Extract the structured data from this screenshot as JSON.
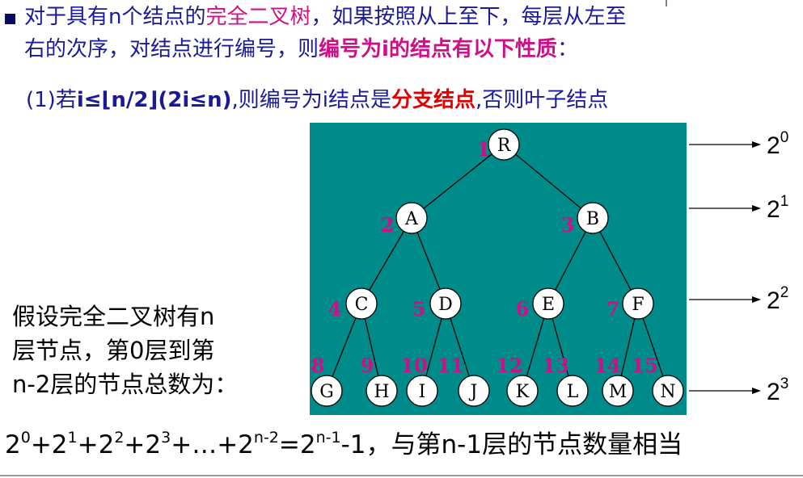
{
  "intro": {
    "line1_a": "对于具有n个结点的",
    "line1_b": "完全二叉树",
    "line1_c": "，如果按照从上至下，每层从左至",
    "line2_a": "右的次序，对结点进行编号，则",
    "line2_b": "编号为i的结点有以下性质",
    "line2_c": "："
  },
  "property": {
    "part_a": "(1)若",
    "part_b": "i≤⌊n/2⌋",
    "part_c": "(2i≤n)",
    "part_d": ",则编号为i结点是",
    "part_e": "分支结点",
    "part_f": ",否则叶子结点"
  },
  "assumption": {
    "line1": "假设完全二叉树有n",
    "line2": "层节点，第0层到第",
    "line3": "n-2层的节点总数为："
  },
  "formula": {
    "t1_base": "2",
    "t1_exp": "0",
    "t2_base": "+2",
    "t2_exp": "1",
    "t3_base": "+2",
    "t3_exp": "2",
    "t4_base": "+2",
    "t4_exp": "3",
    "t5_base": "+…+2",
    "t5_exp": "n-2",
    "t6_base": "=2",
    "t6_exp": "n-1",
    "tail": "-1，与第n-1层的节点数量相当"
  },
  "colors": {
    "panel": "#008b8b",
    "node_fill": "#ffffff",
    "number": "#cc1188",
    "edge": "#000000"
  },
  "tree": {
    "nodes": [
      {
        "id": 1,
        "label": "R"
      },
      {
        "id": 2,
        "label": "A"
      },
      {
        "id": 3,
        "label": "B"
      },
      {
        "id": 4,
        "label": "C"
      },
      {
        "id": 5,
        "label": "D"
      },
      {
        "id": 6,
        "label": "E"
      },
      {
        "id": 7,
        "label": "F"
      },
      {
        "id": 8,
        "label": "G"
      },
      {
        "id": 9,
        "label": "H"
      },
      {
        "id": 10,
        "label": "I"
      },
      {
        "id": 11,
        "label": "J"
      },
      {
        "id": 12,
        "label": "K"
      },
      {
        "id": 13,
        "label": "L"
      },
      {
        "id": 14,
        "label": "M"
      },
      {
        "id": 15,
        "label": "N"
      }
    ],
    "edges": [
      [
        1,
        2
      ],
      [
        1,
        3
      ],
      [
        2,
        4
      ],
      [
        2,
        5
      ],
      [
        3,
        6
      ],
      [
        3,
        7
      ],
      [
        4,
        8
      ],
      [
        4,
        9
      ],
      [
        5,
        10
      ],
      [
        5,
        11
      ],
      [
        6,
        12
      ],
      [
        6,
        13
      ],
      [
        7,
        14
      ],
      [
        7,
        15
      ]
    ],
    "level_counts": [
      {
        "base": "2",
        "exp": "0"
      },
      {
        "base": "2",
        "exp": "1"
      },
      {
        "base": "2",
        "exp": "2"
      },
      {
        "base": "2",
        "exp": "3"
      }
    ]
  }
}
